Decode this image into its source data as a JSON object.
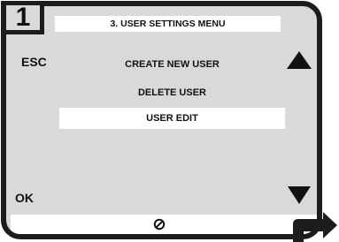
{
  "step": {
    "number": "1"
  },
  "screen": {
    "title": "3. USER SETTINGS MENU",
    "softkeys": {
      "top_left": "ESC",
      "bottom_left": "OK"
    },
    "menu_items": [
      {
        "label": "CREATE NEW USER",
        "selected": false
      },
      {
        "label": "DELETE USER",
        "selected": false
      },
      {
        "label": "USER EDIT",
        "selected": true
      }
    ],
    "status_icon": "no-entry-icon"
  },
  "colors": {
    "background": "#d9d9d9",
    "frame": "#1c1c1c",
    "highlight": "#ffffff"
  }
}
